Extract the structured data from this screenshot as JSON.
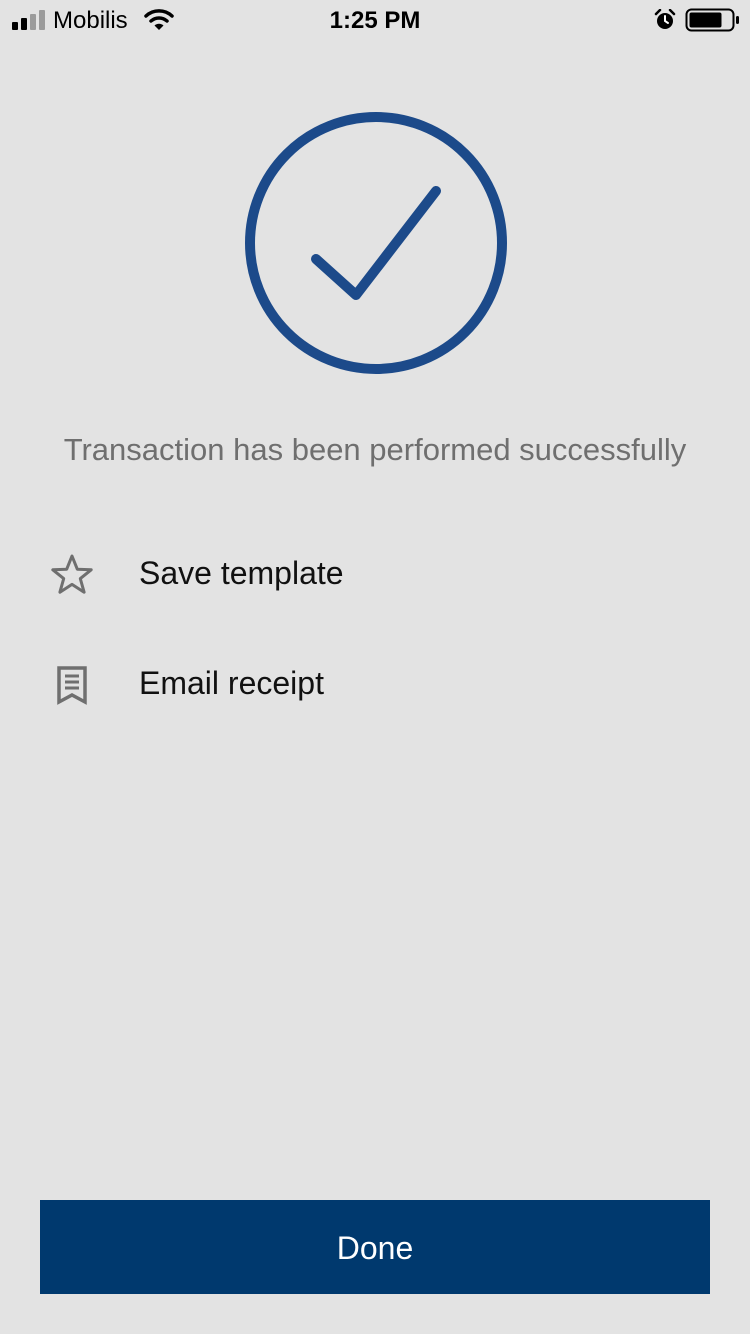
{
  "status_bar": {
    "carrier": "Mobilis",
    "time": "1:25 PM"
  },
  "main": {
    "message": "Transaction has been performed successfully"
  },
  "actions": [
    {
      "label": "Save template",
      "icon": "star-icon"
    },
    {
      "label": "Email receipt",
      "icon": "receipt-icon"
    }
  ],
  "footer": {
    "done_label": "Done"
  },
  "colors": {
    "background": "#e3e3e3",
    "accent": "#1c4a8a",
    "button": "#00396e",
    "message_text": "#6f6f6f",
    "icon_gray": "#6f6f6f"
  }
}
